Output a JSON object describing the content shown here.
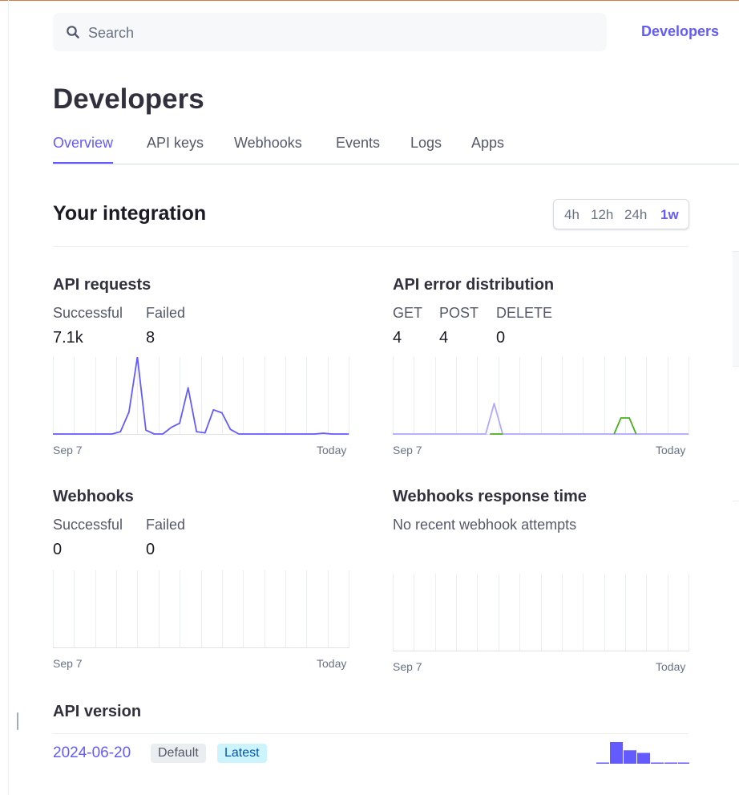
{
  "search": {
    "placeholder": "Search",
    "icon": "search-icon"
  },
  "header": {
    "developers_link": "Developers"
  },
  "page": {
    "title": "Developers"
  },
  "tabs": [
    {
      "label": "Overview",
      "active": true
    },
    {
      "label": "API keys",
      "active": false
    },
    {
      "label": "Webhooks",
      "active": false
    },
    {
      "label": "Events",
      "active": false
    },
    {
      "label": "Logs",
      "active": false
    },
    {
      "label": "Apps",
      "active": false
    }
  ],
  "integration": {
    "title": "Your integration",
    "ranges": [
      {
        "label": "4h",
        "active": false
      },
      {
        "label": "12h",
        "active": false
      },
      {
        "label": "24h",
        "active": false
      },
      {
        "label": "1w",
        "active": true
      }
    ]
  },
  "api_requests": {
    "title": "API requests",
    "metrics": [
      {
        "label": "Successful",
        "value": "7.1k"
      },
      {
        "label": "Failed",
        "value": "8"
      }
    ],
    "x_start": "Sep 7",
    "x_end": "Today"
  },
  "api_errors": {
    "title": "API error distribution",
    "metrics": [
      {
        "label": "GET",
        "value": "4"
      },
      {
        "label": "POST",
        "value": "4"
      },
      {
        "label": "DELETE",
        "value": "0"
      }
    ],
    "x_start": "Sep 7",
    "x_end": "Today"
  },
  "webhooks": {
    "title": "Webhooks",
    "metrics": [
      {
        "label": "Successful",
        "value": "0"
      },
      {
        "label": "Failed",
        "value": "0"
      }
    ],
    "x_start": "Sep 7",
    "x_end": "Today"
  },
  "webhook_response": {
    "title": "Webhooks response time",
    "note": "No recent webhook attempts",
    "x_start": "Sep 7",
    "x_end": "Today"
  },
  "api_version": {
    "title": "API version",
    "version": "2024-06-20",
    "badges": {
      "default": "Default",
      "latest": "Latest"
    }
  },
  "colors": {
    "accent": "#635bff",
    "error_get": "#b1a8ff",
    "error_post": "#47b01c"
  },
  "sparklines": {
    "api_requests": [
      0,
      0,
      0,
      0,
      0,
      0,
      0,
      0,
      0.06,
      0.57,
      2.0,
      0.1,
      0,
      0,
      0.17,
      0.28,
      1.2,
      0.06,
      0.03,
      0.63,
      0.55,
      0.12,
      0,
      0,
      0,
      0,
      0,
      0,
      0,
      0,
      0,
      0,
      0.02,
      0,
      0,
      0
    ],
    "api_errors_get": [
      0,
      0,
      0,
      0,
      0,
      0,
      0,
      0,
      0,
      0,
      0,
      0,
      0,
      0,
      0,
      0,
      0,
      0,
      0,
      0,
      0,
      0,
      0,
      0,
      0,
      0,
      0,
      0,
      0,
      0,
      0,
      0,
      0,
      0,
      0,
      0
    ],
    "api_errors_post": [
      0,
      0,
      0,
      0,
      0,
      0,
      0,
      0,
      0,
      0,
      0,
      0,
      0,
      0,
      0,
      0,
      0,
      0,
      0,
      0,
      0,
      0,
      0,
      0,
      0,
      0,
      0,
      0,
      0,
      0,
      0,
      0,
      0,
      0,
      0,
      0
    ],
    "api_errors_get_spike": [
      0,
      0,
      0,
      0,
      0,
      0,
      0,
      0,
      0,
      0,
      0,
      0,
      0,
      0,
      0,
      0,
      0,
      0,
      0,
      0,
      0,
      0,
      0,
      0,
      0,
      0,
      0,
      0,
      0,
      0,
      0,
      0,
      0,
      0,
      0,
      0
    ],
    "version_usage": [
      0.02,
      1.0,
      0.62,
      0.5,
      0.02,
      0.02,
      0.02
    ]
  }
}
